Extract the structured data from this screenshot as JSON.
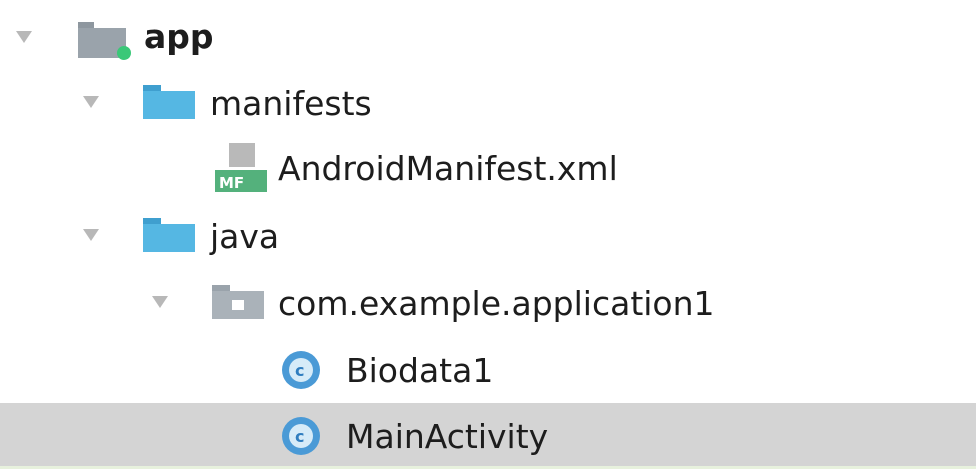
{
  "project_tree": {
    "app": {
      "label": "app"
    },
    "manifests": {
      "label": "manifests"
    },
    "android_manifest": {
      "label": "AndroidManifest.xml",
      "badge": "MF"
    },
    "java": {
      "label": "java"
    },
    "package": {
      "label": "com.example.application1"
    },
    "class_biodata": {
      "label": "Biodata1",
      "badge": "c"
    },
    "class_main_activity": {
      "label": "MainActivity",
      "badge": "c"
    }
  },
  "colors": {
    "folder_blue": "#55b7e3",
    "module_gray": "#9aa3ab",
    "module_dot": "#3ac878",
    "class_badge": "#4a9ad6",
    "manifest_green": "#54b17c",
    "selection": "#d4d4d4",
    "arrow": "#b8b8b8"
  }
}
